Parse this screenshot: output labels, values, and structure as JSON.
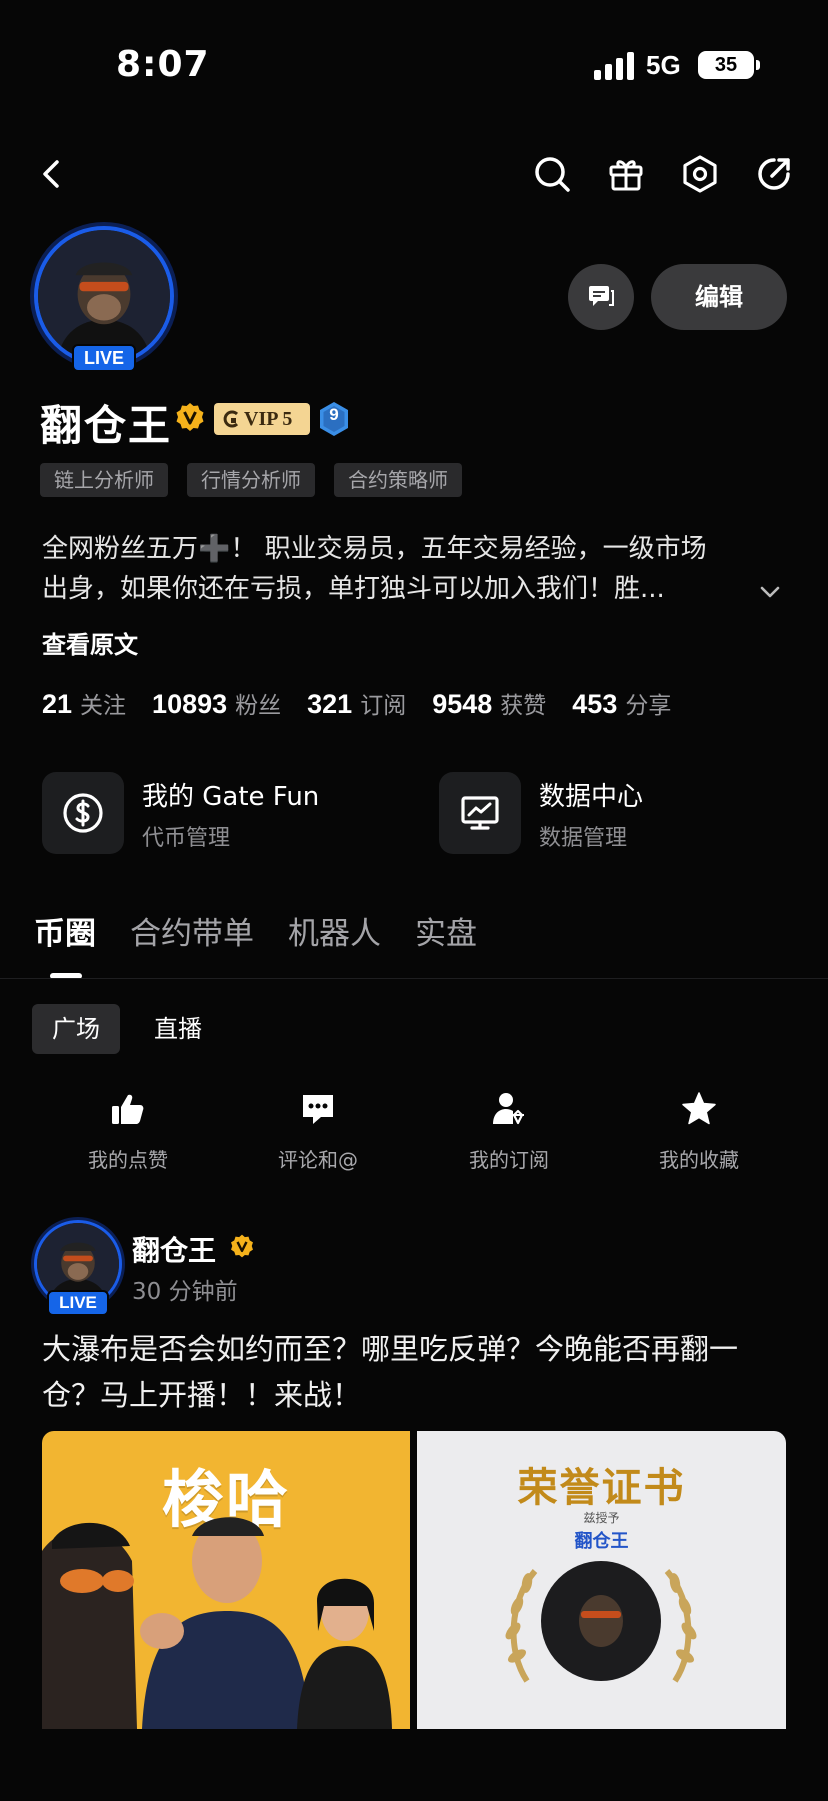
{
  "status_bar": {
    "time": "8:07",
    "network": "5G",
    "battery": "35"
  },
  "profile": {
    "live_label": "LIVE",
    "name": "翻仓王",
    "vip_label": "VIP 5",
    "level": "9",
    "edit_label": "编辑",
    "tags": [
      "链上分析师",
      "行情分析师",
      "合约策略师"
    ],
    "bio_line1": "全网粉丝五万➕！ 职业交易员，五年交易经验，一级市场",
    "bio_line2": "出身，如果你还在亏损，单打独斗可以加入我们！胜...",
    "see_original": "查看原文"
  },
  "stats": [
    {
      "value": "21",
      "label": "关注"
    },
    {
      "value": "10893",
      "label": "粉丝"
    },
    {
      "value": "321",
      "label": "订阅"
    },
    {
      "value": "9548",
      "label": "获赞"
    },
    {
      "value": "453",
      "label": "分享"
    }
  ],
  "cards": [
    {
      "title": "我的 Gate Fun",
      "subtitle": "代币管理",
      "icon": "dollar-circle-icon"
    },
    {
      "title": "数据中心",
      "subtitle": "数据管理",
      "icon": "chart-monitor-icon"
    }
  ],
  "main_tabs": [
    "币圈",
    "合约带单",
    "机器人",
    "实盘"
  ],
  "sub_tabs": [
    "广场",
    "直播"
  ],
  "quick_actions": [
    {
      "label": "我的点赞",
      "icon": "thumbs-up-icon"
    },
    {
      "label": "评论和@",
      "icon": "comment-icon"
    },
    {
      "label": "我的订阅",
      "icon": "user-subscribe-icon"
    },
    {
      "label": "我的收藏",
      "icon": "star-icon"
    }
  ],
  "post": {
    "author": "翻仓王",
    "live_label": "LIVE",
    "time": "30 分钟前",
    "text_line1": "大瀑布是否会如约而至？哪里吃反弹？今晚能否再翻一",
    "text_line2": "仓？马上开播！！来战！",
    "image_left_title": "梭哈",
    "image_right_title": "荣誉证书",
    "image_right_small": "兹授予",
    "image_right_name": "翻仓王"
  },
  "colors": {
    "accent_blue": "#1565e8",
    "vip_gold": "#f4d593",
    "verified_gold": "#f5b21b",
    "background": "#060606"
  }
}
